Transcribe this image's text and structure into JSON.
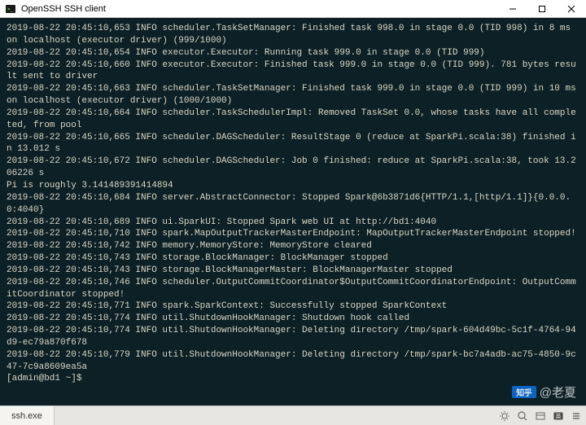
{
  "window": {
    "title": "OpenSSH SSH client"
  },
  "log_lines": [
    "2019-08-22 20:45:10,653 INFO scheduler.TaskSetManager: Finished task 998.0 in stage 0.0 (TID 998) in 8 ms on localhost (executor driver) (999/1000)",
    "2019-08-22 20:45:10,654 INFO executor.Executor: Running task 999.0 in stage 0.0 (TID 999)",
    "2019-08-22 20:45:10,660 INFO executor.Executor: Finished task 999.0 in stage 0.0 (TID 999). 781 bytes result sent to driver",
    "2019-08-22 20:45:10,663 INFO scheduler.TaskSetManager: Finished task 999.0 in stage 0.0 (TID 999) in 10 ms on localhost (executor driver) (1000/1000)",
    "2019-08-22 20:45:10,664 INFO scheduler.TaskSchedulerImpl: Removed TaskSet 0.0, whose tasks have all completed, from pool",
    "2019-08-22 20:45:10,665 INFO scheduler.DAGScheduler: ResultStage 0 (reduce at SparkPi.scala:38) finished in 13.012 s",
    "2019-08-22 20:45:10,672 INFO scheduler.DAGScheduler: Job 0 finished: reduce at SparkPi.scala:38, took 13.206226 s",
    "Pi is roughly 3.141489391414894",
    "2019-08-22 20:45:10,684 INFO server.AbstractConnector: Stopped Spark@6b3871d6{HTTP/1.1,[http/1.1]}{0.0.0.0:4040}",
    "2019-08-22 20:45:10,689 INFO ui.SparkUI: Stopped Spark web UI at http://bd1:4040",
    "2019-08-22 20:45:10,710 INFO spark.MapOutputTrackerMasterEndpoint: MapOutputTrackerMasterEndpoint stopped!",
    "2019-08-22 20:45:10,742 INFO memory.MemoryStore: MemoryStore cleared",
    "2019-08-22 20:45:10,743 INFO storage.BlockManager: BlockManager stopped",
    "2019-08-22 20:45:10,743 INFO storage.BlockManagerMaster: BlockManagerMaster stopped",
    "2019-08-22 20:45:10,746 INFO scheduler.OutputCommitCoordinator$OutputCommitCoordinatorEndpoint: OutputCommitCoordinator stopped!",
    "2019-08-22 20:45:10,771 INFO spark.SparkContext: Successfully stopped SparkContext",
    "2019-08-22 20:45:10,774 INFO util.ShutdownHookManager: Shutdown hook called",
    "2019-08-22 20:45:10,774 INFO util.ShutdownHookManager: Deleting directory /tmp/spark-604d49bc-5c1f-4764-94d9-ec79a870f678",
    "2019-08-22 20:45:10,779 INFO util.ShutdownHookManager: Deleting directory /tmp/spark-bc7a4adb-ac75-4850-9c47-7c9a8609ea5a",
    "[admin@bd1 ~]$"
  ],
  "tabbar": {
    "tabs": [
      "ssh.exe"
    ]
  },
  "watermark": {
    "badge": "知乎",
    "text": "@老夏"
  }
}
